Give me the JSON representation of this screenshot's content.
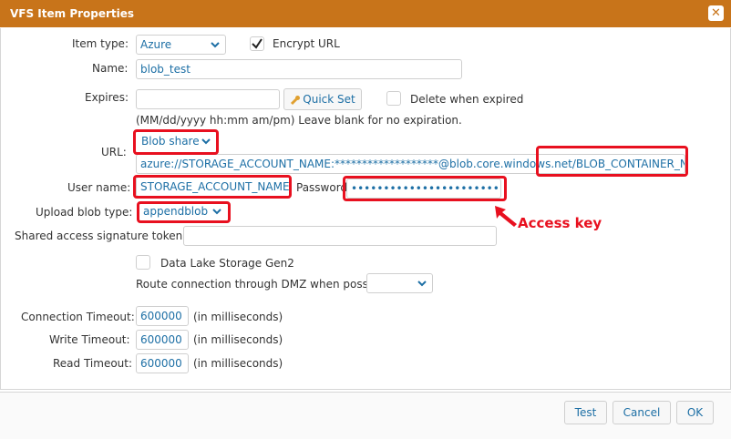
{
  "window": {
    "title": "VFS Item Properties",
    "close_glyph": "✕"
  },
  "labels": {
    "item_type": "Item type:",
    "encrypt_url": "Encrypt URL",
    "name": "Name:",
    "expires": "Expires:",
    "quick_set": "Quick Set",
    "delete_when_expired": "Delete when expired",
    "expires_hint": "(MM/dd/yyyy hh:mm am/pm) Leave blank for no expiration.",
    "url": "URL:",
    "user_name": "User name:",
    "password": "Password",
    "upload_blob_type": "Upload blob type:",
    "sas_token": "Shared access signature token:",
    "data_lake": "Data Lake Storage Gen2",
    "route_dmz": "Route connection through DMZ when possible:",
    "connection_timeout": "Connection Timeout:",
    "write_timeout": "Write Timeout:",
    "read_timeout": "Read Timeout:",
    "in_ms": "(in milliseconds)"
  },
  "values": {
    "item_type": "Azure",
    "name": "blob_test",
    "expires": "",
    "url_type": "Blob share",
    "url": "azure://STORAGE_ACCOUNT_NAME:*******************@blob.core.windows.net/BLOB_CONTAINER_NAME/",
    "user_name": "STORAGE_ACCOUNT_NAME",
    "password": "••••••••••••••••••••••••••",
    "upload_blob_type": "appendblob",
    "sas_token": "",
    "route_dmz": "",
    "connection_timeout": "600000",
    "write_timeout": "600000",
    "read_timeout": "600000",
    "encrypt_url_checked": true,
    "delete_when_expired_checked": false,
    "data_lake_checked": false
  },
  "annotation": {
    "text": "Access key",
    "color": "#e8101f"
  },
  "buttons": {
    "test": "Test",
    "cancel": "Cancel",
    "ok": "OK"
  },
  "colors": {
    "title_bar": "#c8741a",
    "link_text": "#1d6fa5",
    "highlight": "#e8101f"
  }
}
